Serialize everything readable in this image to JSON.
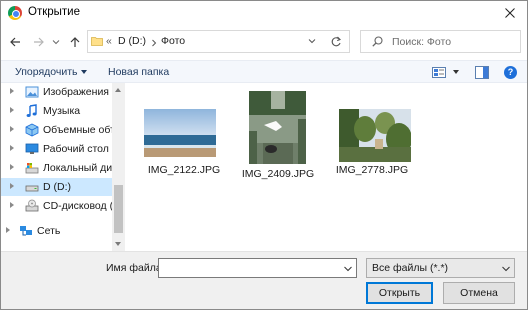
{
  "window": {
    "title": "Открытие"
  },
  "nav": {
    "breadcrumb_prefix": "«",
    "breadcrumb": [
      "D (D:)",
      "Фото"
    ],
    "search_placeholder": "Поиск: Фото"
  },
  "command_bar": {
    "organize_label": "Упорядочить",
    "new_folder_label": "Новая папка"
  },
  "sidebar": {
    "items": [
      {
        "label": "Изображения",
        "icon": "pictures-icon"
      },
      {
        "label": "Музыка",
        "icon": "music-icon"
      },
      {
        "label": "Объемные объекты",
        "icon": "3d-objects-icon"
      },
      {
        "label": "Рабочий стол",
        "icon": "desktop-icon"
      },
      {
        "label": "Локальный диск (C:)",
        "icon": "local-disk-icon"
      },
      {
        "label": "D (D:)",
        "icon": "drive-icon",
        "selected": true
      },
      {
        "label": "CD-дисковод (F:)",
        "icon": "cd-drive-icon"
      },
      {
        "label": "Сеть",
        "icon": "network-icon"
      }
    ]
  },
  "files": [
    {
      "name": "IMG_2122.JPG"
    },
    {
      "name": "IMG_2409.JPG"
    },
    {
      "name": "IMG_2778.JPG"
    }
  ],
  "footer": {
    "filename_label": "Имя файла:",
    "filename_value": "",
    "filter_value": "Все файлы (*.*)",
    "open_label": "Открыть",
    "cancel_label": "Отмена"
  },
  "colors": {
    "accent": "#0078d7",
    "selection": "#cce8ff"
  }
}
